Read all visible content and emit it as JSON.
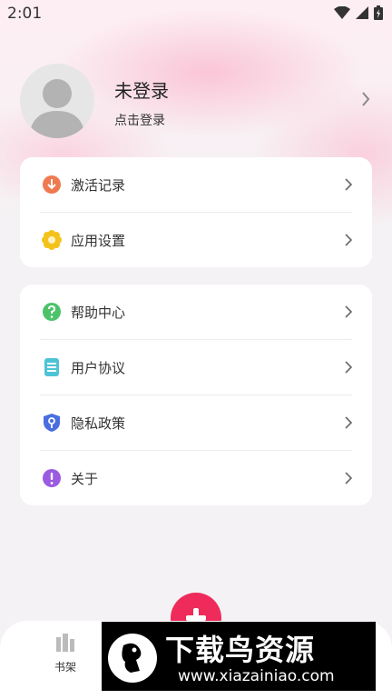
{
  "status_bar": {
    "time": "2:01"
  },
  "profile": {
    "name": "未登录",
    "subtitle": "点击登录"
  },
  "menu_group_1": [
    {
      "label": "激活记录",
      "icon": "download-circle-icon",
      "color": "#ef7a4f"
    },
    {
      "label": "应用设置",
      "icon": "gear-flower-icon",
      "color": "#f3c21c"
    }
  ],
  "menu_group_2": [
    {
      "label": "帮助中心",
      "icon": "question-circle-icon",
      "color": "#4cc36a"
    },
    {
      "label": "用户协议",
      "icon": "document-icon",
      "color": "#4fc3d6"
    },
    {
      "label": "隐私政策",
      "icon": "shield-icon",
      "color": "#4a6ee0"
    },
    {
      "label": "关于",
      "icon": "info-circle-icon",
      "color": "#9b5be0"
    }
  ],
  "bottom_nav": {
    "shelf_label": "书架"
  },
  "watermark": {
    "title": "下载鸟资源",
    "url": "www.xiazainiao.com"
  },
  "colors": {
    "accent": "#ee2b5a",
    "background": "#f4f2f4"
  }
}
